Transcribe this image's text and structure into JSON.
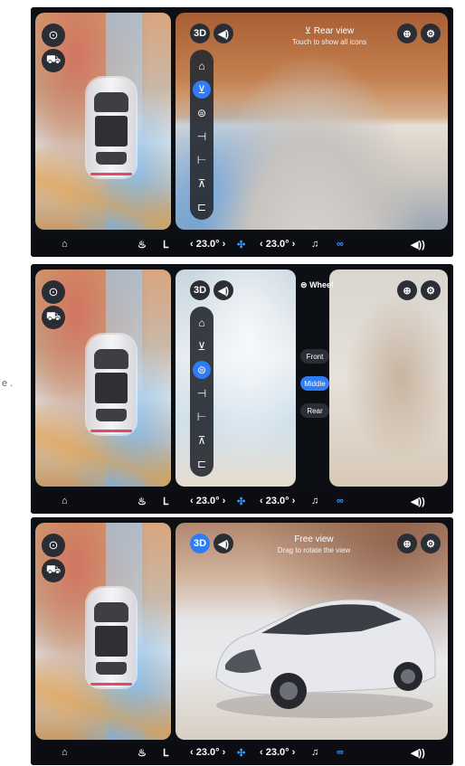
{
  "margin_text": "e .",
  "common": {
    "btn_3d": "3D",
    "home_icon": "⌂",
    "seat_heat_icon": "♨",
    "seat_icon": "ᒪ",
    "temp_left": "‹ 23.0° ›",
    "fan_icon": "✣",
    "temp_right": "‹ 23.0° ›",
    "wiper_icon": "♫",
    "car_link_icon": "∞",
    "volume_icon": "◀))",
    "steering_icon": "⊙",
    "car_icon": "⛟",
    "record_icon": "⊕",
    "settings_icon": "⚙",
    "sound_icon": "◀)"
  },
  "screen1": {
    "header_icon": "⊻",
    "header_title": "Rear view",
    "header_subtitle": "Touch to show all icons"
  },
  "screen2": {
    "wheel_label": "Wheel",
    "wheel_icon": "⊜",
    "options": [
      "Front",
      "Middle",
      "Rear"
    ],
    "active_option": "Middle"
  },
  "screen3": {
    "header_title": "Free view",
    "header_subtitle": "Drag to rotate the view"
  }
}
